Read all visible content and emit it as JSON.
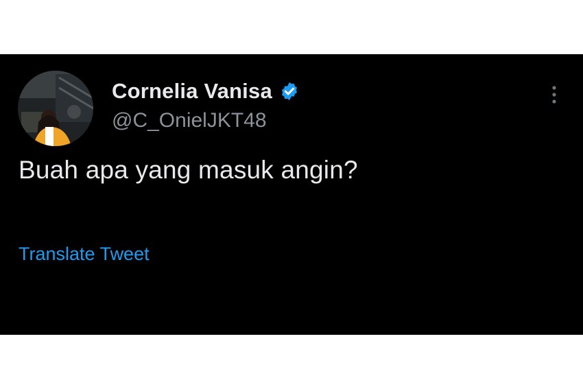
{
  "tweet": {
    "author": {
      "display_name": "Cornelia Vanisa",
      "handle": "@C_OnielJKT48",
      "verified": true,
      "avatar_icon": "avatar"
    },
    "text": "Buah apa yang masuk angin?",
    "translate_label": "Translate Tweet",
    "more_icon": "more-vertical-icon"
  },
  "colors": {
    "background": "#000000",
    "text_primary": "#e7e9ea",
    "text_secondary": "#8b9299",
    "accent": "#1d9bf0"
  }
}
